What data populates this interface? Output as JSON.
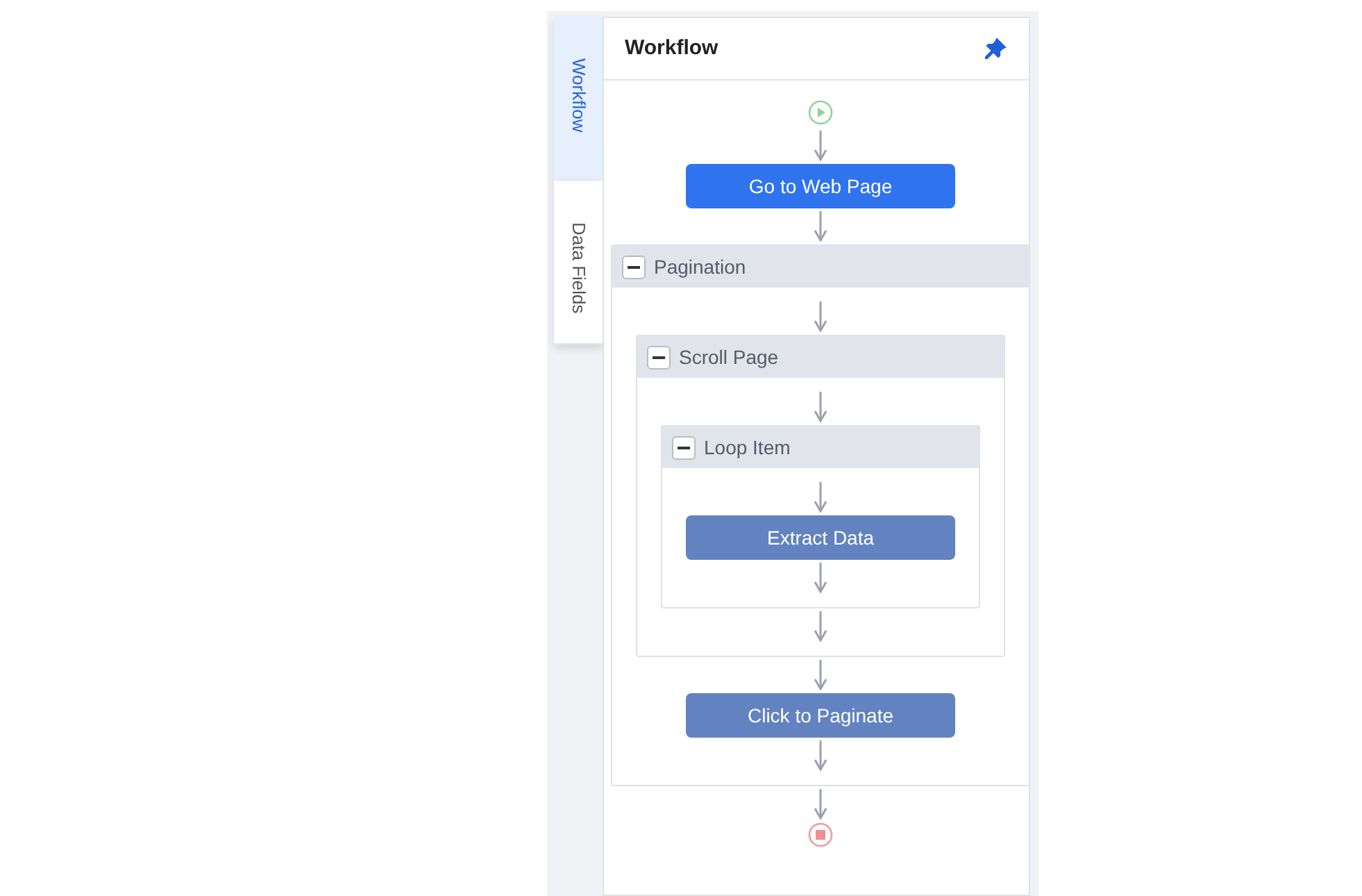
{
  "side_tabs": [
    {
      "label": "Workflow",
      "selected": true
    },
    {
      "label": "Data Fields",
      "selected": false
    }
  ],
  "panel": {
    "title": "Workflow",
    "pinned": true
  },
  "workflow": {
    "steps": [
      {
        "kind": "action",
        "label": "Go to Web Page",
        "selected": true
      },
      {
        "kind": "group",
        "label": "Pagination",
        "expanded": true,
        "children": [
          {
            "kind": "group",
            "label": "Scroll Page",
            "expanded": true,
            "children": [
              {
                "kind": "group",
                "label": "Loop Item",
                "expanded": true,
                "children": [
                  {
                    "kind": "action",
                    "label": "Extract Data",
                    "selected": false
                  }
                ]
              }
            ]
          },
          {
            "kind": "action",
            "label": "Click to Paginate",
            "selected": false
          }
        ]
      }
    ]
  }
}
